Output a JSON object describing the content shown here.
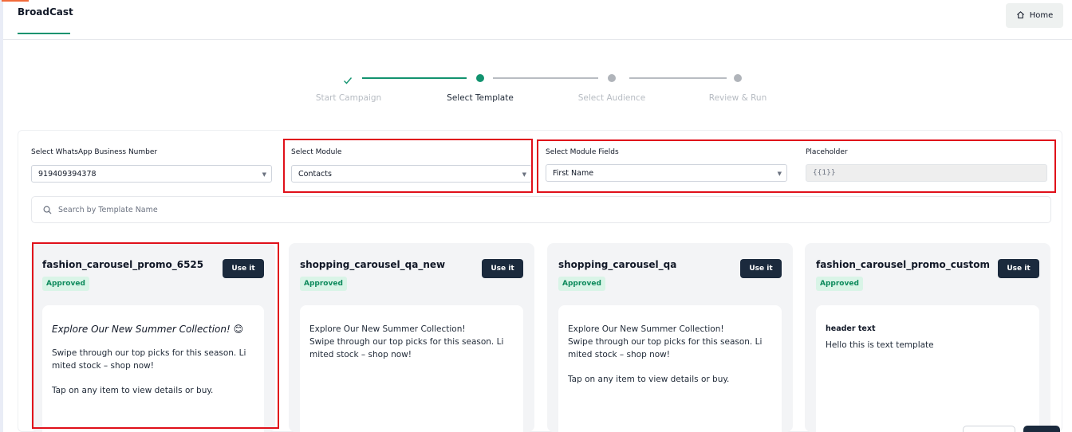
{
  "header": {
    "title": "BroadCast",
    "home_label": "Home",
    "home_icon": "home-icon",
    "accent_color": "#12936f"
  },
  "stepper": {
    "steps": [
      {
        "label": "Start Campaign",
        "state": "completed"
      },
      {
        "label": "Select Template",
        "state": "active"
      },
      {
        "label": "Select Audience",
        "state": "pending"
      },
      {
        "label": "Review & Run",
        "state": "pending"
      }
    ]
  },
  "form": {
    "business_number_label": "Select WhatsApp Business Number",
    "business_number_value": "919409394378",
    "module_label": "Select Module",
    "module_value": "Contacts",
    "module_fields_label": "Select Module Fields",
    "module_fields_value": "First Name",
    "placeholder_label": "Placeholder",
    "placeholder_value": "{{1}}"
  },
  "search": {
    "placeholder": "Search by Template Name"
  },
  "templates": [
    {
      "name": "fashion_carousel_promo_6525",
      "status": "Approved",
      "action": "Use it",
      "header": "Explore Our New Summer Collection! 😊",
      "lines": [
        "Swipe through our top picks for this season. Li",
        "mited stock – shop now!",
        "",
        "Tap on any item to view details or buy."
      ]
    },
    {
      "name": "shopping_carousel_qa_new",
      "status": "Approved",
      "action": "Use it",
      "lines": [
        "Explore Our New Summer Collection!",
        "Swipe through our top picks for this season. Li",
        "mited stock – shop now!"
      ]
    },
    {
      "name": "shopping_carousel_qa",
      "status": "Approved",
      "action": "Use it",
      "lines": [
        "Explore Our New Summer Collection!",
        "Swipe through our top picks for this season. Li",
        "mited stock – shop now!",
        "",
        "Tap on any item to view details or buy."
      ]
    },
    {
      "name": "fashion_carousel_promo_custom",
      "status": "Approved",
      "action": "Use it",
      "header": "header text",
      "lines": [
        "Hello this is text template"
      ]
    }
  ],
  "colors": {
    "highlight_border": "#e0101a",
    "approved_bg": "#d9f4e7",
    "approved_text": "#0d8a5c",
    "button_dark": "#1b2a3d"
  }
}
